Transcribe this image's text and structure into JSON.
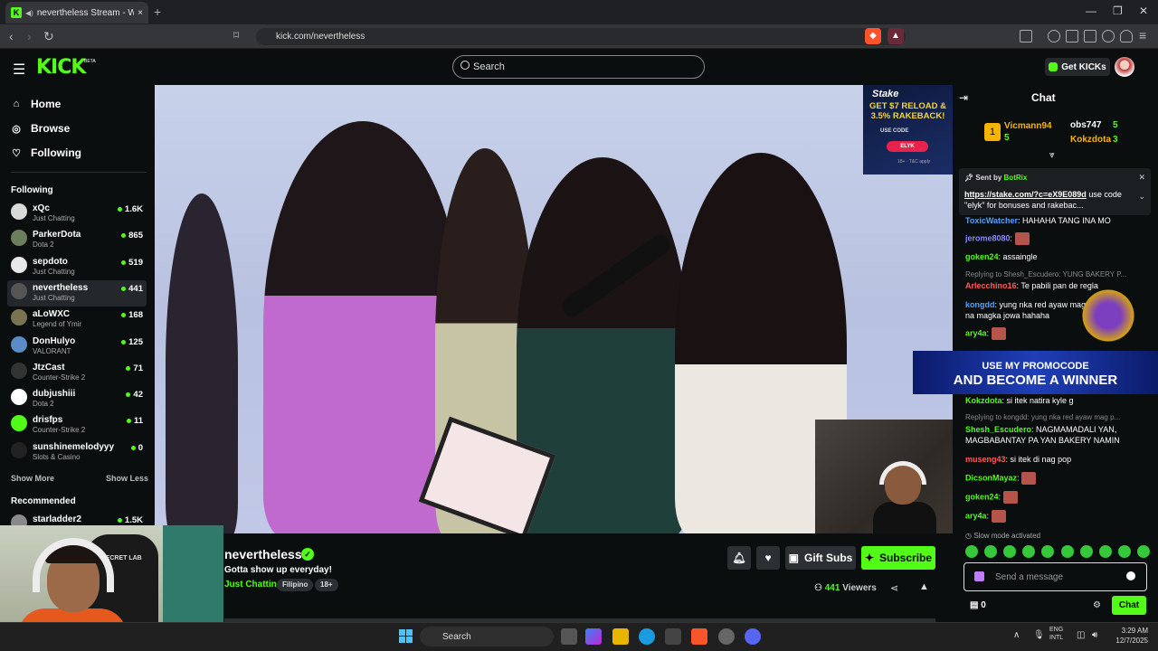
{
  "browser": {
    "tab_title": "nevertheless Stream - Watch",
    "url": "kick.com/nevertheless",
    "new_tab": "+",
    "tab_close": "×"
  },
  "header": {
    "logo": "KICK",
    "beta": "BETA",
    "search_placeholder": "Search",
    "get_kicks": "Get KICKs"
  },
  "sidebar": {
    "nav": [
      {
        "label": "Home",
        "icon": "home-icon"
      },
      {
        "label": "Browse",
        "icon": "compass-icon"
      },
      {
        "label": "Following",
        "icon": "heart-icon"
      }
    ],
    "following_title": "Following",
    "following": [
      {
        "name": "xQc",
        "category": "Just Chatting",
        "viewers": "1.6K",
        "color": "#d9d9d9"
      },
      {
        "name": "ParkerDota",
        "category": "Dota 2",
        "viewers": "865",
        "color": "#6d7e5c"
      },
      {
        "name": "sepdoto",
        "category": "Just Chatting",
        "viewers": "519",
        "color": "#e8e8e8"
      },
      {
        "name": "nevertheless",
        "category": "Just Chatting",
        "viewers": "441",
        "color": "#555"
      },
      {
        "name": "aLoWXC",
        "category": "Legend of Ymir",
        "viewers": "168",
        "color": "#7a7352"
      },
      {
        "name": "DonHulyo",
        "category": "VALORANT",
        "viewers": "125",
        "color": "#5a8cc8"
      },
      {
        "name": "JtzCast",
        "category": "Counter-Strike 2",
        "viewers": "71",
        "color": "#333"
      },
      {
        "name": "dubjushiii",
        "category": "Dota 2",
        "viewers": "42",
        "color": "#fff"
      },
      {
        "name": "drisfps",
        "category": "Counter-Strike 2",
        "viewers": "11",
        "color": "#53fc18"
      },
      {
        "name": "sunshinemelodyyy",
        "category": "Slots & Casino",
        "viewers": "0",
        "color": "#222"
      }
    ],
    "show_more": "Show More",
    "show_less": "Show Less",
    "recommended_title": "Recommended",
    "recommended": [
      {
        "name": "starladder2",
        "viewers": "1.5K"
      }
    ]
  },
  "ad": {
    "brand": "Stake",
    "headline": "GET $7 RELOAD & 3.5% RAKEBACK!",
    "use_code": "USE CODE",
    "code": "ELYK",
    "fine": "18+ · T&C apply"
  },
  "webcam": {
    "logo": "SECRET LAB"
  },
  "stream": {
    "name": "nevertheless",
    "title": "Gotta show up everyday!",
    "category": "Just Chatting",
    "tags": [
      "Filipino",
      "18+"
    ],
    "gift_subs": "Gift Subs",
    "subscribe": "Subscribe",
    "viewers_count": "441",
    "viewers_label": "Viewers"
  },
  "chat": {
    "title": "Chat",
    "leaderboard": [
      {
        "rank": "1",
        "name": "Vicmann94",
        "count": "5"
      },
      {
        "name": "obs747",
        "count": "5"
      },
      {
        "name": "Kokzdota",
        "count": "3"
      }
    ],
    "pinned": {
      "sent_by": "Sent by",
      "sender": "BotRix",
      "link": "https://stake.com/?c=eX9E089d",
      "text": " use code \"elyk\" for bonuses and rakebac..."
    },
    "messages": [
      {
        "user": "ToxicWatcher",
        "text": "HAHAHA TANG INA MO",
        "color": "#4fa3ff"
      },
      {
        "user": "jerome8080",
        "text": "",
        "color": "#8a8aff"
      },
      {
        "user": "goken24",
        "text": "assaingle",
        "color": "#53fc18"
      },
      {
        "reply": "Replying to Shesh_Escudero: YUNG BAKERY P..."
      },
      {
        "user": "Arlecchino16",
        "text": "Te pabili pan de regla",
        "color": "#ff5a5a"
      },
      {
        "user": "kongdd",
        "text": "yung nka red ayaw mag pop",
        "text2": "na magka jowa hahaha",
        "color": "#4fa3ff"
      },
      {
        "user": "ary4a",
        "text": "",
        "color": "#53fc18"
      },
      {
        "user": "Kokzdota",
        "text": "si itek natira kyle g",
        "color": "#53fc18"
      },
      {
        "reply": "Replying to kongdd: yung nka red ayaw mag p..."
      },
      {
        "user": "Shesh_Escudero",
        "text": "NAGMAMADALI YAN,",
        "text2": "MAGBABANTAY PA YAN BAKERY NAMIN",
        "color": "#53fc18"
      },
      {
        "user": "museng43",
        "text": "si itek di nag pop",
        "color": "#ff5a5a"
      },
      {
        "user": "DicsonMayaz",
        "text": "",
        "color": "#53fc18"
      },
      {
        "user": "goken24",
        "text": "",
        "color": "#53fc18"
      },
      {
        "user": "ary4a",
        "text": "",
        "color": "#53fc18"
      }
    ],
    "promo_line1": "USE MY PROMOCODE",
    "promo_line2": "AND BECOME A WINNER",
    "slow_mode": "Slow mode activated",
    "input_placeholder": "Send a message",
    "points": "0",
    "send": "Chat"
  },
  "taskbar": {
    "search": "Search",
    "lang1": "ENG",
    "lang2": "INTL",
    "time": "3:29 AM",
    "date": "12/7/2025"
  }
}
